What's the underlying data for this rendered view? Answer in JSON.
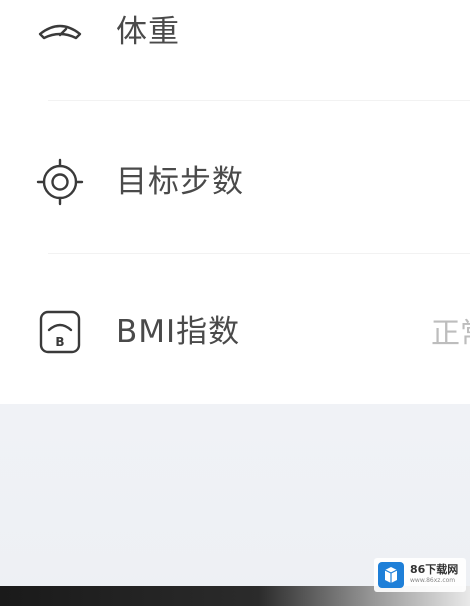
{
  "rows": [
    {
      "label": "体重",
      "icon": "gauge-icon"
    },
    {
      "label": "目标步数",
      "icon": "target-icon"
    },
    {
      "label": "BMI指数",
      "icon": "bmi-icon",
      "value": "正常"
    }
  ],
  "watermark": {
    "title": "86下载网",
    "url": "www.86xz.com"
  },
  "colors": {
    "label": "#4a4a4a",
    "value": "#bdbdbd",
    "icon": "#3a3a3a",
    "list_background": "#ffffff",
    "page_background": "#eff1f5",
    "watermark_blue": "#1e7fd8"
  }
}
